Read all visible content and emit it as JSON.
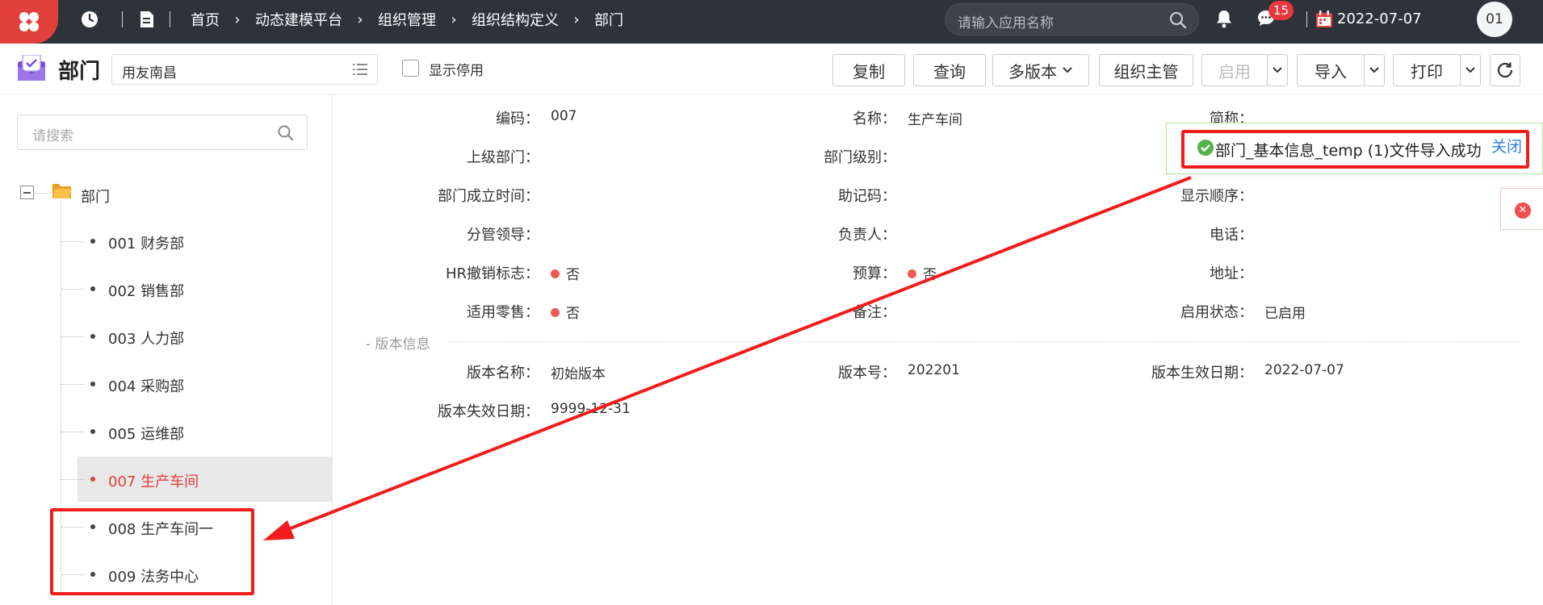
{
  "topbar": {
    "breadcrumb": [
      "首页",
      "动态建模平台",
      "组织管理",
      "组织结构定义",
      "部门"
    ],
    "search_placeholder": "请输入应用名称",
    "message_count": "15",
    "date": "2022-07-07",
    "avatar": "01"
  },
  "toolbar": {
    "title": "部门",
    "org": "用友南昌",
    "show_disabled": "显示停用",
    "buttons": {
      "copy": "复制",
      "query": "查询",
      "multi_version": "多版本",
      "org_manager": "组织主管",
      "enable": "启用",
      "import": "导入",
      "print": "打印"
    }
  },
  "sidebar": {
    "search_placeholder": "请搜索",
    "root": "部门",
    "items": [
      "001 财务部",
      "002 销售部",
      "003 人力部",
      "004 采购部",
      "005 运维部",
      "007 生产车间",
      "008 生产车间一",
      "009 法务中心"
    ],
    "active_index": 5
  },
  "form": {
    "code_label": "编码：",
    "code": "007",
    "name_label": "名称：",
    "name": "生产车间",
    "short_label": "简称：",
    "parent_label": "上级部门：",
    "level_label": "部门级别：",
    "found_label": "部门成立时间：",
    "mnemonic_label": "助记码：",
    "order_label": "显示顺序：",
    "leader_label": "分管领导：",
    "owner_label": "负责人：",
    "phone_label": "电话：",
    "hr_label": "HR撤销标志：",
    "hr": "否",
    "budget_label": "预算：",
    "budget": "否",
    "address_label": "地址：",
    "retail_label": "适用零售：",
    "retail": "否",
    "note_label": "备注：",
    "status_label": "启用状态：",
    "status": "已启用"
  },
  "version": {
    "section": "- 版本信息",
    "name_label": "版本名称：",
    "name": "初始版本",
    "no_label": "版本号：",
    "no": "202201",
    "start_label": "版本生效日期：",
    "start": "2022-07-07",
    "end_label": "版本失效日期：",
    "end": "9999-12-31"
  },
  "notification": {
    "message": "部门_基本信息_temp (1)文件导入成功",
    "close": "关闭"
  },
  "colors": {
    "accent": "#e1403d",
    "topbar": "#2e3239",
    "link": "#2f7de1",
    "annotation": "#f11c1c"
  }
}
